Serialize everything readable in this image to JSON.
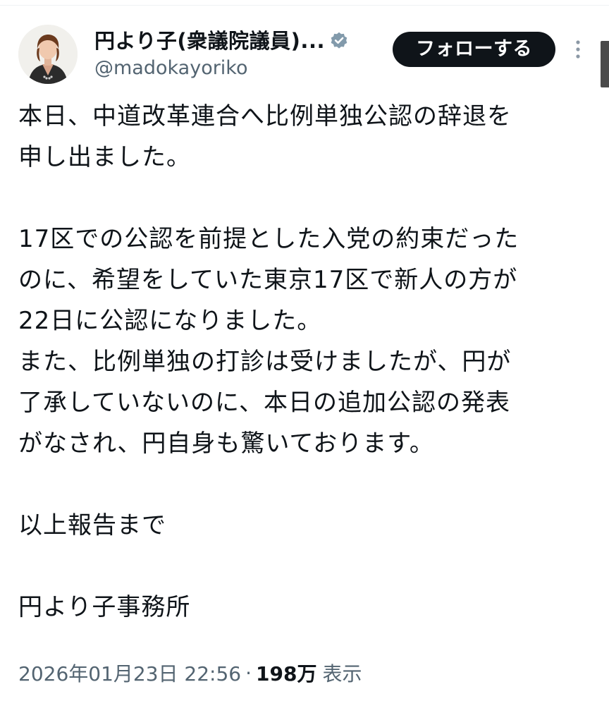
{
  "author": {
    "display_name": "円より子(衆議院議員)...",
    "handle": "@madokayoriko",
    "avatar_icon": "profile-photo-avatar",
    "verified_icon": "verified-badge-icon",
    "verified_color": "#829aab"
  },
  "actions": {
    "follow_label": "フォローする",
    "follow_bg": "#0f1419",
    "more_icon": "more-vertical-icon"
  },
  "tweet": {
    "lines": [
      "本日、中道改革連合へ比例単独公認の辞退を",
      "申し出ました。",
      "",
      "17区での公認を前提とした入党の約束だった",
      "のに、希望をしていた東京17区で新人の方が",
      "22日に公認になりました。",
      "また、比例単独の打診は受けましたが、円が",
      "了承していないのに、本日の追加公認の発表",
      "がなされ、円自身も驚いております。",
      "",
      "以上報告まで",
      "",
      "円より子事務所"
    ]
  },
  "meta": {
    "timestamp": "2026年01月23日 22:56",
    "separator": "·",
    "views_count": "198万",
    "views_label": "表示"
  },
  "colors": {
    "text_primary": "#0f1419",
    "text_secondary": "#536471",
    "divider": "#eff3f4"
  }
}
